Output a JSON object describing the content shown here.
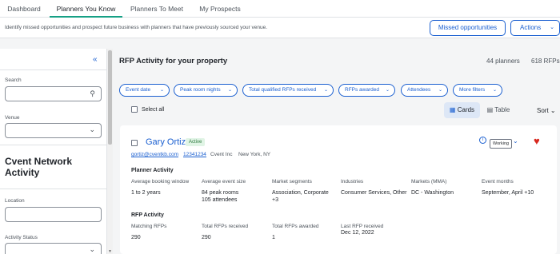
{
  "nav": {
    "tabs": [
      {
        "label": "Dashboard"
      },
      {
        "label": "Planners You Know"
      },
      {
        "label": "Planners To Meet"
      },
      {
        "label": "My Prospects"
      }
    ],
    "active_tab": "Planners You Know"
  },
  "subbar": {
    "description": "Identify missed opportunities and prospect future business with planners that have previously sourced your venue.",
    "missed_label": "Missed opportunities",
    "actions_label": "Actions",
    "actions_icon": "chevron-down-icon"
  },
  "sidebar": {
    "collapse_icon": "double-chevron-left-icon",
    "search_label": "Search",
    "search_icon": "search-icon",
    "venue_label": "Venue",
    "network_title": "Cvent Network Activity",
    "location_label": "Location",
    "activity_status_label": "Activity Status"
  },
  "main": {
    "title": "RFP Activity for your property",
    "planners_count": "44 planners",
    "rfps_count": "618 RFPs",
    "filters": [
      {
        "label": "Event date"
      },
      {
        "label": "Peak room nights"
      },
      {
        "label": "Total qualified RFPs received"
      },
      {
        "label": "RFPs awarded"
      },
      {
        "label": "Attendees"
      },
      {
        "label": "More filters"
      }
    ],
    "select_all_label": "Select all",
    "view": {
      "cards_label": "Cards",
      "table_label": "Table",
      "selected": "Cards"
    },
    "sort_label": "Sort"
  },
  "card": {
    "name": "Gary Ortiz",
    "badge": "Active",
    "email": "gortiz@cventkb.com",
    "phone": "12341234",
    "company": "Cvent Inc",
    "location": "New York, NY",
    "status": "Working",
    "planner_activity": {
      "title": "Planner Activity",
      "cols": [
        {
          "label": "Average booking window",
          "value": "1 to 2 years",
          "value2": ""
        },
        {
          "label": "Average event size",
          "value": "84 peak rooms",
          "value2": "105 attendees"
        },
        {
          "label": "Market segments",
          "value": "Association, Corporate",
          "value2": "+3"
        },
        {
          "label": "Industries",
          "value": "Consumer Services, Other",
          "value2": ""
        },
        {
          "label": "Markets (MMA)",
          "value": "DC - Washington",
          "value2": ""
        },
        {
          "label": "Event months",
          "value": "September, April +10",
          "value2": ""
        }
      ]
    },
    "rfp_activity": {
      "title": "RFP Activity",
      "cols": [
        {
          "label": "Matching RFPs",
          "value": "290"
        },
        {
          "label": "Total RFPs received",
          "value": "290"
        },
        {
          "label": "Total RFPs awarded",
          "value": "1"
        },
        {
          "label": "Last RFP received",
          "value": "Dec 12, 2022"
        }
      ]
    }
  },
  "colors": {
    "accent": "#1a5fd0",
    "tab_underline": "#16a085",
    "heart": "#d8281e",
    "badge_bg": "#e0f4e5"
  }
}
